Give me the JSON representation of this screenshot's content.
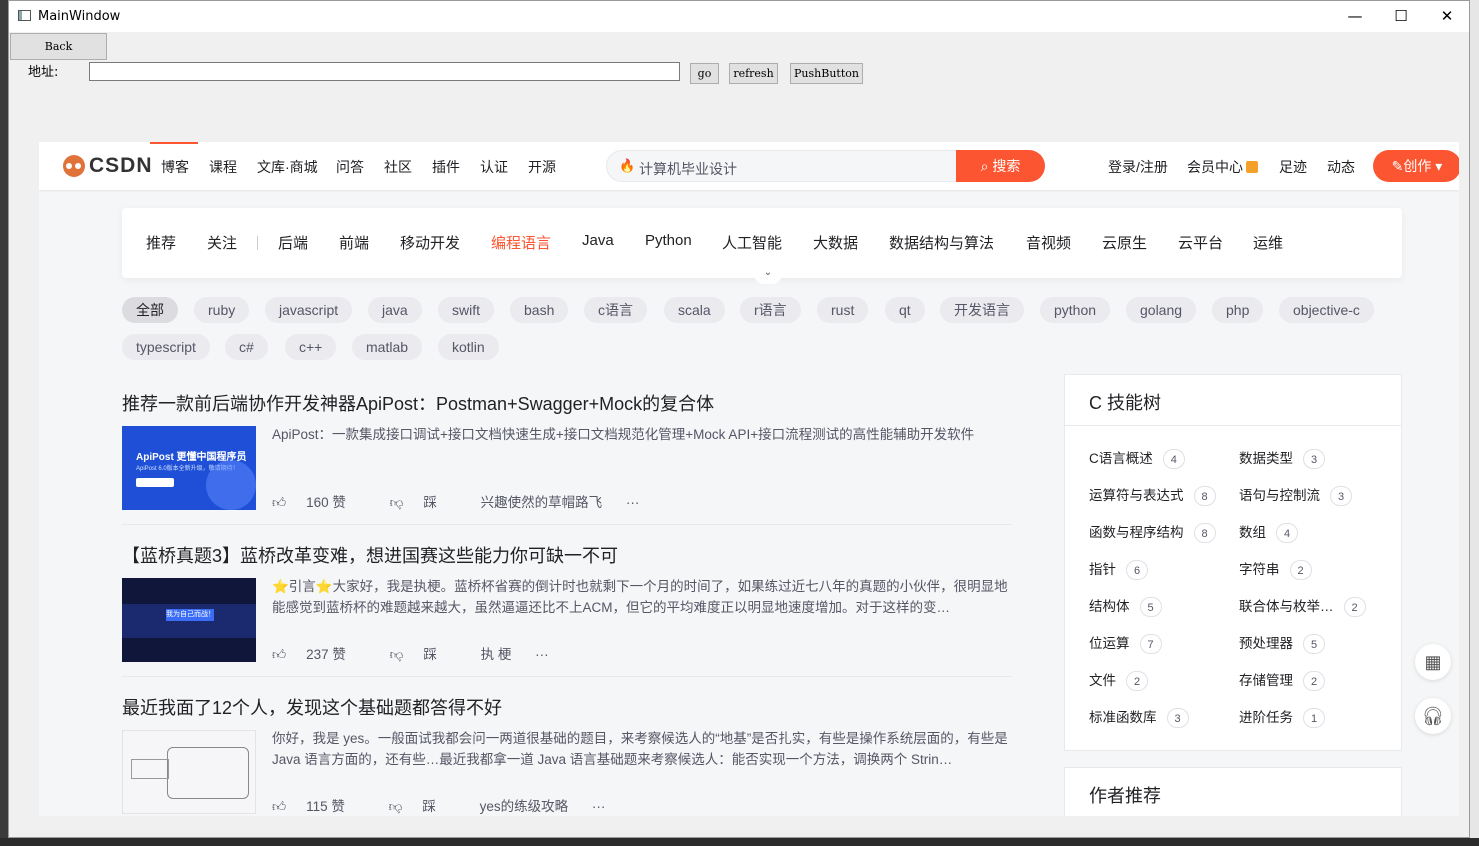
{
  "window": {
    "title": "MainWindow",
    "minimize": "—",
    "maximize": "☐",
    "close": "✕"
  },
  "toolbar": {
    "back_label": "Back",
    "address_label": "地址:",
    "address_value": "",
    "go_label": "go",
    "refresh_label": "refresh",
    "push_label": "PushButton"
  },
  "csdn": {
    "logo_text": "CSDN",
    "nav": [
      "博客",
      "课程",
      "文库·商城",
      "问答",
      "社区",
      "插件",
      "认证",
      "开源"
    ],
    "search_placeholder": "计算机毕业设计",
    "search_button": "搜索",
    "right_nav": [
      "登录/注册",
      "会员中心",
      "足迹",
      "动态"
    ],
    "create_button": "创作 ▾",
    "categories": [
      "推荐",
      "关注",
      "后端",
      "前端",
      "移动开发",
      "编程语言",
      "Java",
      "Python",
      "人工智能",
      "大数据",
      "数据结构与算法",
      "音视频",
      "云原生",
      "云平台",
      "运维"
    ],
    "active_category": "编程语言",
    "tags_row1": [
      "全部",
      "ruby",
      "javascript",
      "java",
      "swift",
      "bash",
      "c语言",
      "scala",
      "r语言",
      "rust",
      "qt",
      "开发语言",
      "python",
      "golang",
      "php",
      "objective-c"
    ],
    "tags_row2": [
      "typescript",
      "c#",
      "c++",
      "matlab",
      "kotlin"
    ],
    "articles": [
      {
        "title": "推荐一款前后端协作开发神器ApiPost：Postman+Swagger+Mock的复合体",
        "desc": "ApiPost：一款集成接口调试+接口文档快速生成+接口文档规范化管理+Mock API+接口流程测试的高性能辅助开发软件",
        "likes": "160 赞",
        "dislike": "踩",
        "author": "兴趣使然的草帽路飞",
        "more": "···",
        "thumb_title": "ApiPost 更懂中国程序员",
        "thumb_sub": "ApiPost 6.0版本全新升级，敬请期待！"
      },
      {
        "title": "【蓝桥真题3】蓝桥改革变难，想进国赛这些能力你可缺一不可",
        "desc": "⭐引言⭐大家好，我是执梗。蓝桥杯省赛的倒计时也就剩下一个月的时间了，如果练过近七八年的真题的小伙伴，很明显地能感觉到蓝桥杯的难题越来越大，虽然逼逼还比不上ACM，但它的平均难度正以明显地速度增加。对于这样的变…",
        "likes": "237 赞",
        "dislike": "踩",
        "author": "执 梗",
        "more": "···",
        "thumb_title": "我为自己而战！"
      },
      {
        "title": "最近我面了12个人，发现这个基础题都答得不好",
        "desc": "你好，我是 yes。一般面试我都会问一两道很基础的题目，来考察候选人的“地基”是否扎实，有些是操作系统层面的，有些是 Java 语言方面的，还有些…最近我都拿一道 Java 语言基础题来考察候选人：能否实现一个方法，调换两个 Strin…",
        "likes": "115 赞",
        "dislike": "踩",
        "author": "yes的练级攻略",
        "more": "···"
      }
    ],
    "skill_tree": {
      "title": "C 技能树",
      "items": [
        {
          "name": "C语言概述",
          "count": "4"
        },
        {
          "name": "数据类型",
          "count": "3"
        },
        {
          "name": "运算符与表达式",
          "count": "8"
        },
        {
          "name": "语句与控制流",
          "count": "3"
        },
        {
          "name": "函数与程序结构",
          "count": "8"
        },
        {
          "name": "数组",
          "count": "4"
        },
        {
          "name": "指针",
          "count": "6"
        },
        {
          "name": "字符串",
          "count": "2"
        },
        {
          "name": "结构体",
          "count": "5"
        },
        {
          "name": "联合体与枚举…",
          "count": "2"
        },
        {
          "name": "位运算",
          "count": "7"
        },
        {
          "name": "预处理器",
          "count": "5"
        },
        {
          "name": "文件",
          "count": "2"
        },
        {
          "name": "存储管理",
          "count": "2"
        },
        {
          "name": "标准函数库",
          "count": "3"
        },
        {
          "name": "进阶任务",
          "count": "1"
        }
      ]
    },
    "author_section": "作者推荐",
    "float_icons": [
      "qrcode-icon",
      "headset-icon"
    ]
  },
  "colors": {
    "accent": "#fc5531",
    "window_bg": "#f0f0f0",
    "page_bg": "#f5f6f7"
  }
}
